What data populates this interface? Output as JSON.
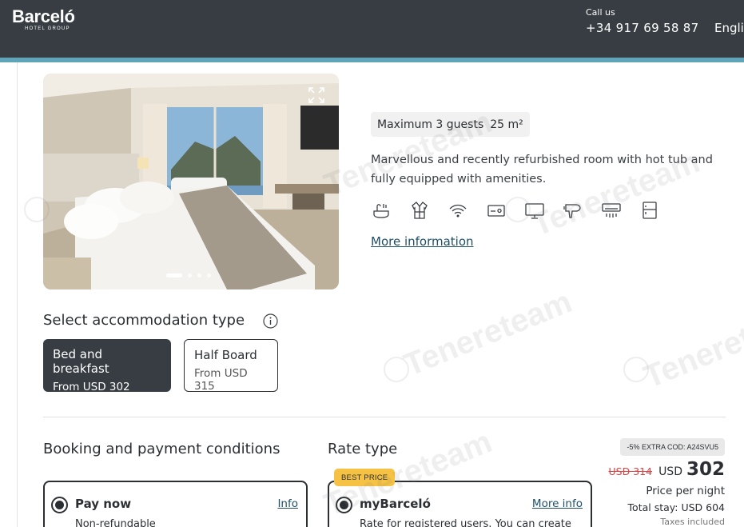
{
  "header": {
    "logo_main": "Barceló",
    "logo_sub": "HOTEL GROUP",
    "call_label": "Call us",
    "phone": "+34 917 69 58 87",
    "language": "Engli"
  },
  "room": {
    "guests": "Maximum 3 guests",
    "size": "25 m²",
    "description": "Marvellous and recently refurbished room with hot tub and fully equipped with amenities.",
    "more_info": "More information",
    "amenities": [
      "hot-tub-icon",
      "bathrobe-icon",
      "wifi-icon",
      "safe-box-icon",
      "tv-icon",
      "hairdryer-icon",
      "air-conditioning-icon",
      "minibar-icon"
    ],
    "carousel": {
      "total": 4,
      "active": 1
    }
  },
  "accommodation": {
    "title": "Select accommodation type",
    "options": [
      {
        "name": "Bed and breakfast",
        "price": "From USD 302",
        "selected": true
      },
      {
        "name": "Half Board",
        "price": "From USD 315",
        "selected": false
      }
    ]
  },
  "booking": {
    "title": "Booking and payment conditions",
    "option_label": "Pay now",
    "option_info": "Info",
    "option_sub": "Non-refundable"
  },
  "rate": {
    "title": "Rate type",
    "badge": "BEST PRICE",
    "option_label": "myBarceló",
    "option_info": "More info",
    "option_sub": "Rate for registered users. You can create"
  },
  "price": {
    "promo": "-5% EXTRA COD: A24SVU5",
    "old": "USD 314",
    "currency": "USD",
    "amount": "302",
    "per_night": "Price per night",
    "total": "Total stay: USD 604",
    "taxes": "Taxes included"
  },
  "watermark": "Tenereteam",
  "colors": {
    "header_bg": "#373d42",
    "accent_stripe": "#5fa4b8",
    "link": "#1f4f66",
    "badge": "#f5c243",
    "strike": "#d64545"
  }
}
